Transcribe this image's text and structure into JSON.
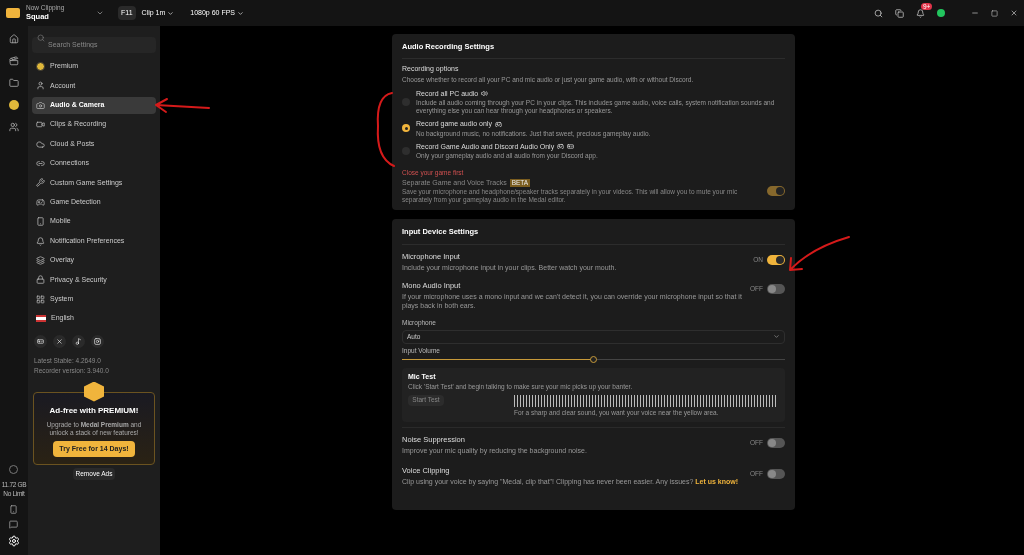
{
  "topbar": {
    "now_label": "Now Clipping",
    "game": "Squad",
    "hotkey": "F11",
    "clip_length": "Clip 1m",
    "quality": "1080p 60 FPS",
    "notification_count": "9+"
  },
  "rail": {
    "storage": "11.72 GB",
    "limit": "No Limit"
  },
  "sidebar": {
    "search_placeholder": "Search Settings",
    "items": [
      {
        "label": "Premium",
        "selected": false
      },
      {
        "label": "Account",
        "selected": false
      },
      {
        "label": "Audio & Camera",
        "selected": true
      },
      {
        "label": "Clips & Recording",
        "selected": false
      },
      {
        "label": "Cloud & Posts",
        "selected": false
      },
      {
        "label": "Connections",
        "selected": false
      },
      {
        "label": "Custom Game Settings",
        "selected": false
      },
      {
        "label": "Game Detection",
        "selected": false
      },
      {
        "label": "Mobile",
        "selected": false
      },
      {
        "label": "Notification Preferences",
        "selected": false
      },
      {
        "label": "Overlay",
        "selected": false
      },
      {
        "label": "Privacy & Security",
        "selected": false
      },
      {
        "label": "System",
        "selected": false
      },
      {
        "label": "English",
        "selected": false
      }
    ],
    "versions": [
      "Latest Stable: 4.2649.0",
      "Recorder version: 3.940.0"
    ],
    "promo": {
      "title": "Ad-free with **PREMIUM!**",
      "text": "Upgrade to **Medal Premium** and unlock a stack of new features!",
      "button": "Try Free for 14 Days!",
      "remove": "Remove Ads"
    }
  },
  "audio_recording": {
    "title": "Audio Recording Settings",
    "options_title": "Recording options",
    "options_text": "Choose whether to record all your PC and mic audio or just your game audio, with or without Discord.",
    "options": [
      {
        "label": "Record all PC audio",
        "text": "Include all audio coming through your PC in your clips. This includes game audio, voice calls, system notification sounds and everything else you can hear through your headphones or speakers.",
        "selected": false
      },
      {
        "label": "Record game audio only",
        "text": "No background music, no notifications. Just that sweet, precious gameplay audio.",
        "selected": true
      },
      {
        "label": "Record Game Audio and Discord Audio Only",
        "text": "Only your gameplay audio and all audio from your Discord app.",
        "selected": false
      }
    ],
    "warning": "Close your game first",
    "tracks_title": "Separate Game and Voice Tracks",
    "tracks_badge": "BETA",
    "tracks_text": "Save your microphone and headphone/speaker tracks separately in your videos. This will allow you to mute your mic separately from your gameplay audio in the Medal editor.",
    "tracks_on": true
  },
  "input_device": {
    "title": "Input Device Settings",
    "toggles": [
      {
        "title": "Microphone Input",
        "text": "Include your microphone input in your clips. Better watch your mouth.",
        "state": "ON",
        "on": true
      },
      {
        "title": "Mono Audio Input",
        "text": "If your microphone uses a mono input and we can't detect it, you can override your microphone input so that it plays back in both ears.",
        "state": "OFF",
        "on": false
      }
    ],
    "microphone_label": "Microphone",
    "microphone_value": "Auto",
    "volume": {
      "label": "Input Volume",
      "level": 0.5
    },
    "mic_test": {
      "title": "Mic Test",
      "text": "Click 'Start Test' and begin talking to make sure your mic picks up your banter.",
      "button": "Start Test",
      "hint": "For a sharp and clear sound, you want your voice near the yellow area."
    },
    "toggles2": [
      {
        "title": "Noise Suppression",
        "text": "Improve your mic quality by reducing the background noise.",
        "state": "OFF",
        "on": false
      },
      {
        "title": "Voice Clipping",
        "text": "Clip using your voice by saying \"Medal, clip that\"! Clipping has never been easier. Any issues?",
        "link": "Let us know!",
        "state": "OFF",
        "on": false
      }
    ]
  }
}
